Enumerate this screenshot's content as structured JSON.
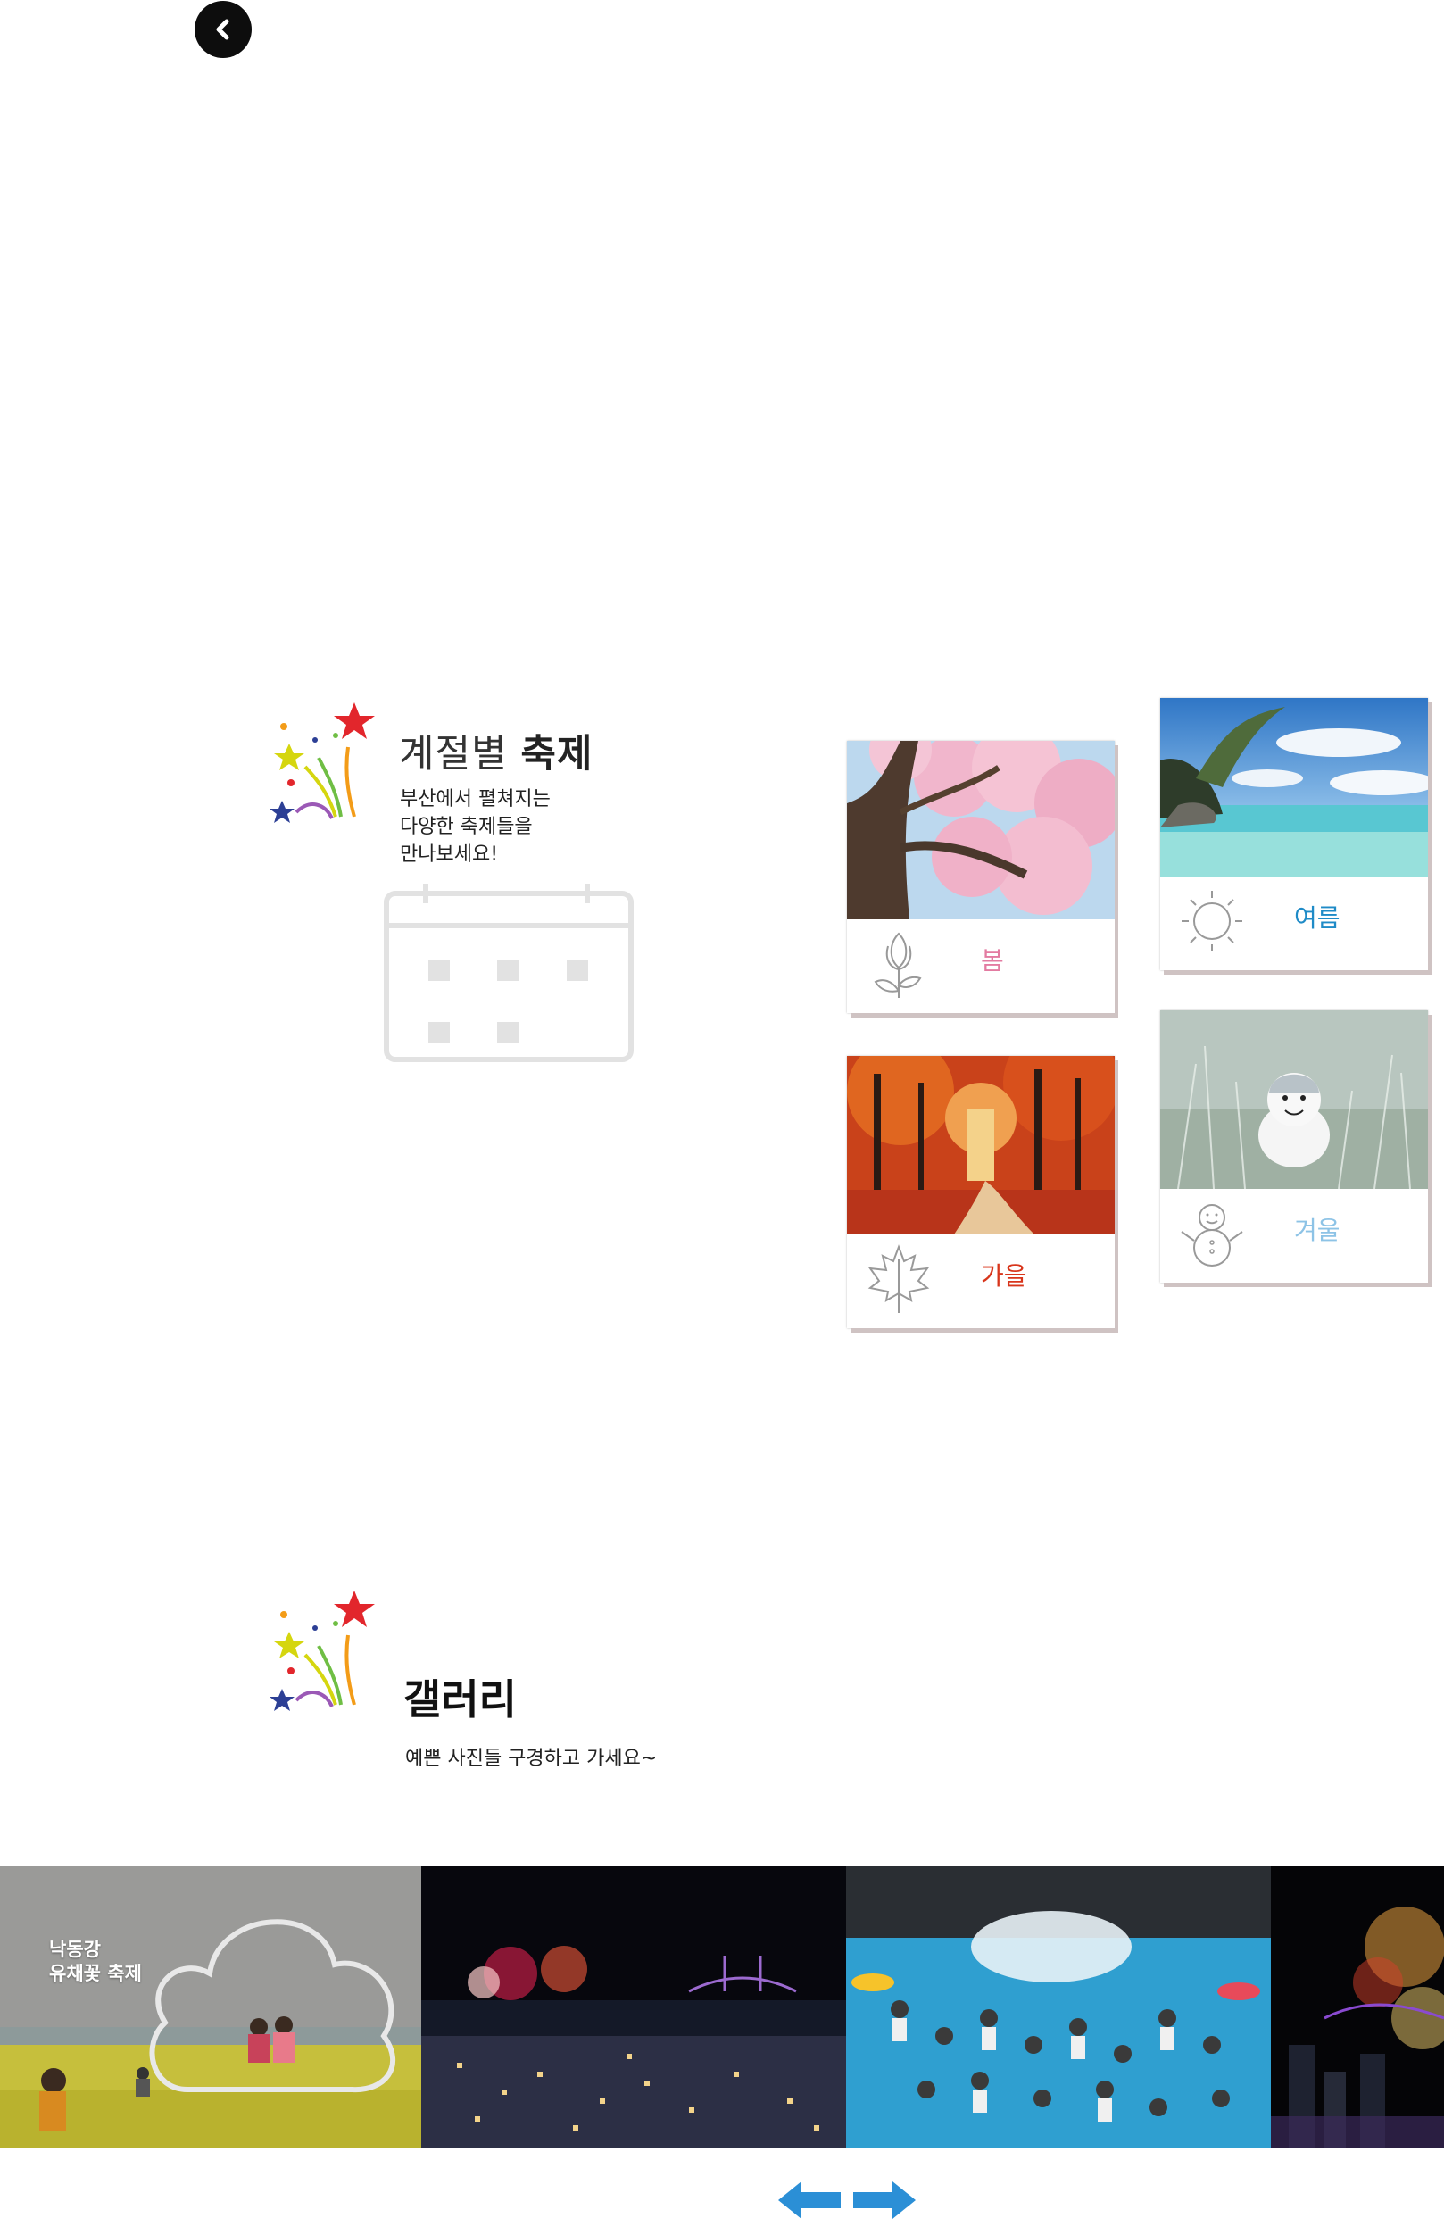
{
  "nav": {
    "back_icon": "chevron-left-icon"
  },
  "season_section": {
    "title_prefix": "계절별",
    "title_bold": "축제",
    "description": "부산에서 펼쳐지는\n다양한 축제들을\n만나보세요!",
    "decor_icon": "fireworks-stars-icon",
    "calendar_icon": "calendar-icon",
    "seasons": [
      {
        "label": "봄",
        "icon": "tulip-icon",
        "color": "#e37ba1"
      },
      {
        "label": "여름",
        "icon": "sun-icon",
        "color": "#1f8bc7"
      },
      {
        "label": "가을",
        "icon": "maple-leaf-icon",
        "color": "#d8351b"
      },
      {
        "label": "겨울",
        "icon": "snowman-icon",
        "color": "#8dc3e6"
      }
    ]
  },
  "gallery_section": {
    "title": "갤러리",
    "description": "예쁜 사진들 구경하고 가세요~",
    "decor_icon": "fireworks-stars-icon",
    "items": [
      {
        "caption": "낙동강\n유채꽃 축제",
        "icon": "cloud-outline-icon"
      },
      {
        "caption": ""
      },
      {
        "caption": ""
      },
      {
        "caption": ""
      }
    ],
    "prev_icon": "arrow-left-icon",
    "next_icon": "arrow-right-icon",
    "arrow_color": "#2b8fd6"
  }
}
